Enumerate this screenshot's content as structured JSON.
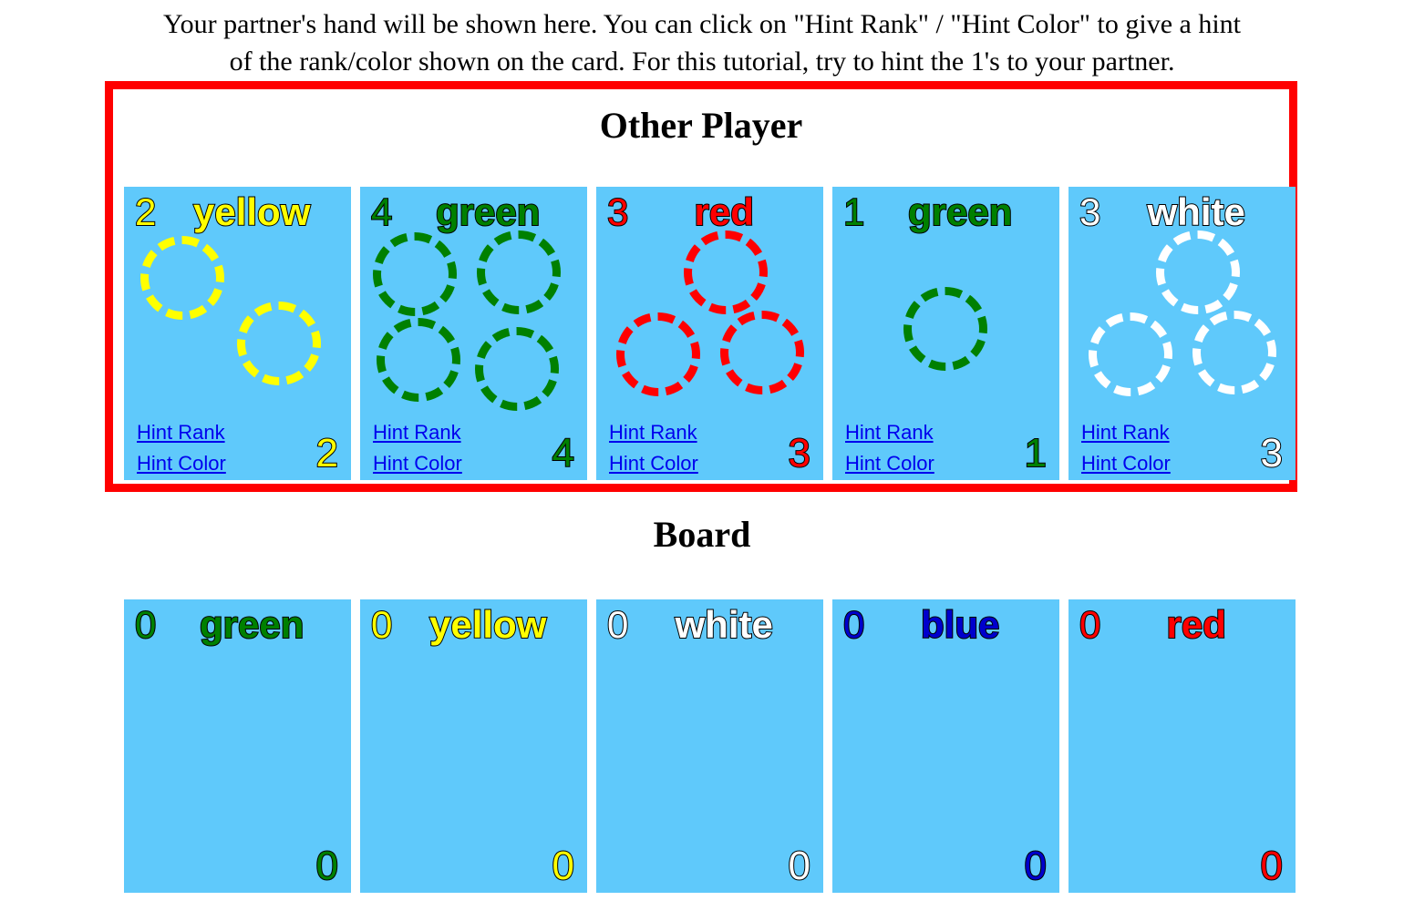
{
  "instructions": {
    "line1": "Your partner's hand will be shown here. You can click on \"Hint Rank\" / \"Hint Color\" to give a hint",
    "line2": "of the rank/color shown on the card. For this tutorial, try to hint the 1's to your partner."
  },
  "colors": {
    "card_background": "#5fc9fb",
    "highlight_border": "#ff0000",
    "link": "#0000ee",
    "yellow": "#ffff00",
    "green": "#008000",
    "red": "#ff0000",
    "white": "#ffffff",
    "blue": "#0000cd",
    "page_background": "#ffffff"
  },
  "player_section": {
    "heading": "Other Player",
    "highlighted": true,
    "hint_rank_label": "Hint Rank",
    "hint_color_label": "Hint Color",
    "cards": [
      {
        "rank": "2",
        "color": "yellow",
        "burst_count": 2,
        "burst_icon": "firework-burst-icon"
      },
      {
        "rank": "4",
        "color": "green",
        "burst_count": 4,
        "burst_icon": "firework-burst-icon"
      },
      {
        "rank": "3",
        "color": "red",
        "burst_count": 3,
        "burst_icon": "firework-burst-icon"
      },
      {
        "rank": "1",
        "color": "green",
        "burst_count": 1,
        "burst_icon": "firework-burst-icon"
      },
      {
        "rank": "3",
        "color": "white",
        "burst_count": 3,
        "burst_icon": "firework-burst-icon"
      }
    ]
  },
  "board_section": {
    "heading": "Board",
    "cards": [
      {
        "rank": "0",
        "color": "green",
        "burst_count": 0
      },
      {
        "rank": "0",
        "color": "yellow",
        "burst_count": 0
      },
      {
        "rank": "0",
        "color": "white",
        "burst_count": 0
      },
      {
        "rank": "0",
        "color": "blue",
        "burst_count": 0
      },
      {
        "rank": "0",
        "color": "red",
        "burst_count": 0
      }
    ]
  }
}
